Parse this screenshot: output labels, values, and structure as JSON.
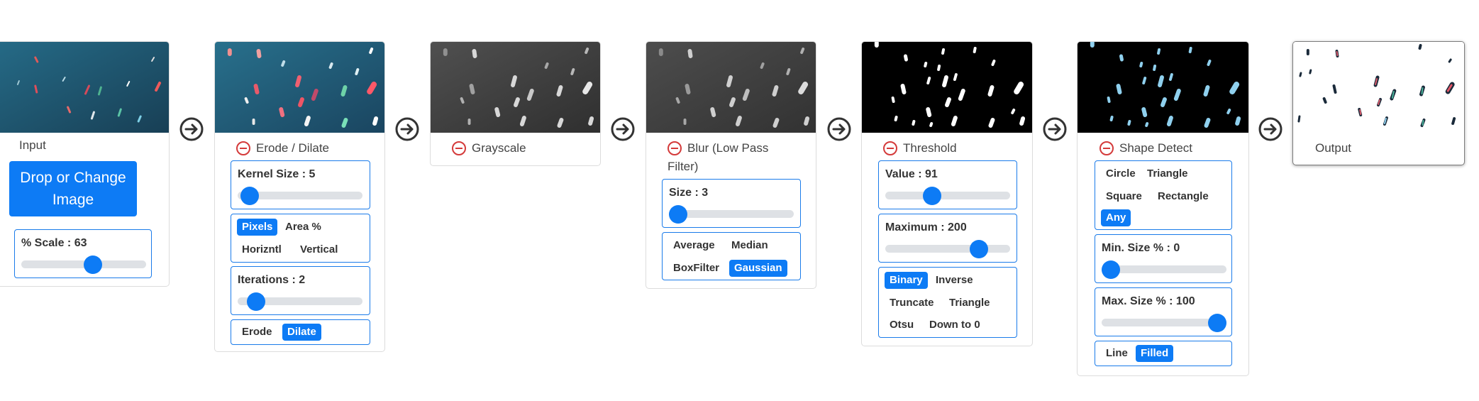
{
  "colors": {
    "accent": "#0d7bf5",
    "remove": "#d43a3a",
    "arrow": "#333333",
    "sea": "#1e4f68",
    "mask": "#000000",
    "shape_fill": "#8fd0ee"
  },
  "input": {
    "title": "Input",
    "drop_button": "Drop or Change Image",
    "scale_label": "% Scale : 63",
    "scale_value": 63
  },
  "erode": {
    "title": "Erode / Dilate",
    "kernel_label": "Kernel Size : 5",
    "kernel_value": 5,
    "units": [
      "Pixels",
      "Area %"
    ],
    "units_selected": "Pixels",
    "directions": [
      "Horizntl",
      "Vertical"
    ],
    "iterations_label": "Iterations : 2",
    "iterations_value": 2,
    "modes": [
      "Erode",
      "Dilate"
    ],
    "mode_selected": "Dilate"
  },
  "grayscale": {
    "title": "Grayscale"
  },
  "blur": {
    "title": "Blur (Low Pass Filter)",
    "size_label": "Size : 3",
    "size_value": 3,
    "methods": [
      "Average",
      "Median",
      "BoxFilter",
      "Gaussian"
    ],
    "method_selected": "Gaussian"
  },
  "threshold": {
    "title": "Threshold",
    "value_label": "Value : 91",
    "value": 91,
    "maximum_label": "Maximum : 200",
    "maximum": 200,
    "types": [
      "Binary",
      "Inverse",
      "Truncate",
      "Triangle",
      "Otsu",
      "Down to 0"
    ],
    "type_selected": "Binary"
  },
  "shape": {
    "title": "Shape Detect",
    "shapes": [
      "Circle",
      "Triangle",
      "Square",
      "Rectangle",
      "Any"
    ],
    "shape_selected": "Any",
    "min_label": "Min. Size % : 0",
    "min_value": 0,
    "max_label": "Max. Size % : 100",
    "max_value": 100,
    "fills": [
      "Line",
      "Filled"
    ],
    "fill_selected": "Filled"
  },
  "output": {
    "title": "Output"
  }
}
